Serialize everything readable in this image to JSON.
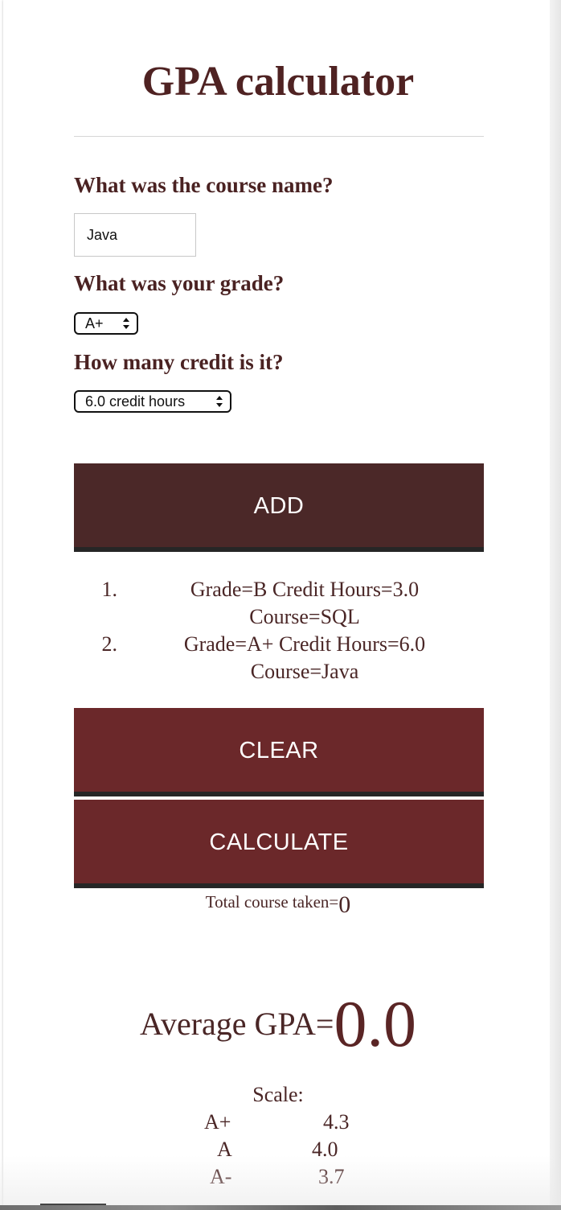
{
  "page": {
    "title": "GPA calculator"
  },
  "form": {
    "course_label": "What was the course name?",
    "course_value": "Java",
    "grade_label": "What was your grade?",
    "grade_selected": "A+",
    "credit_label": "How many credit is it?",
    "credit_selected": "6.0 credit hours"
  },
  "buttons": {
    "add": "ADD",
    "clear": "CLEAR",
    "calculate": "CALCULATE"
  },
  "courses": [
    {
      "num": "1.",
      "line1": "Grade=B Credit Hours=3.0",
      "line2": "Course=SQL"
    },
    {
      "num": "2.",
      "line1": "Grade=A+ Credit Hours=6.0",
      "line2": "Course=Java"
    }
  ],
  "results": {
    "total_label": "Total course taken=",
    "total_value": "0",
    "avg_label": "Average GPA=",
    "avg_value": "0.0"
  },
  "scale": {
    "title": "Scale:",
    "rows": [
      {
        "grade": "A+",
        "points": "4.3"
      },
      {
        "grade": "A",
        "points": "4.0"
      },
      {
        "grade": "A-",
        "points": "3.7"
      }
    ]
  },
  "colors": {
    "title_text": "#4f2222",
    "add_button": "#4b2828",
    "clear_button": "#6b282a",
    "calculate_button": "#6b282a"
  }
}
